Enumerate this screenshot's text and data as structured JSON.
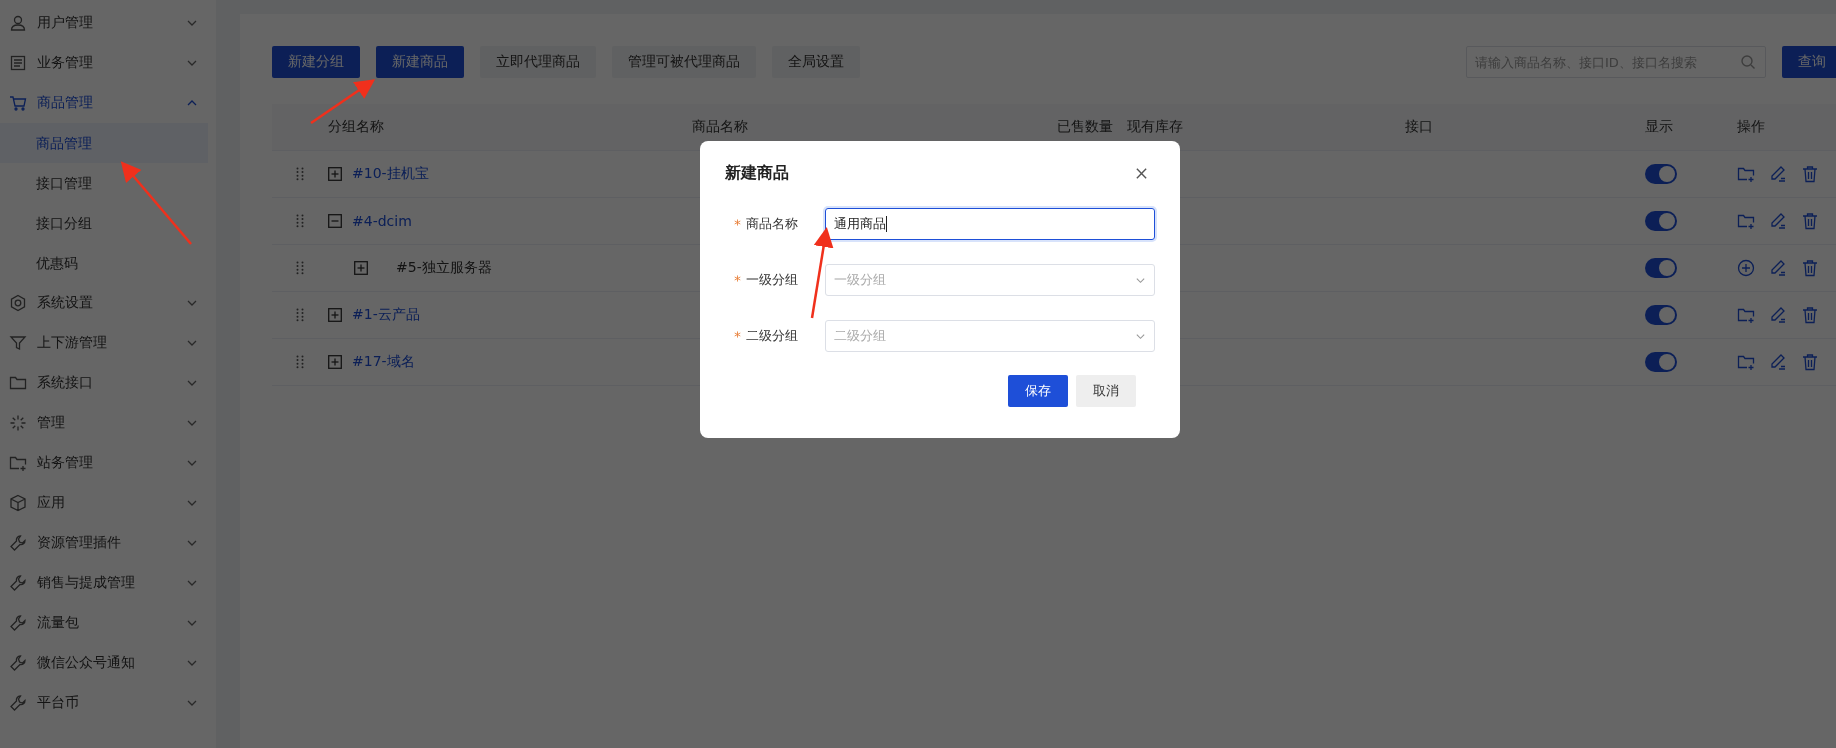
{
  "sidebar": {
    "items": [
      {
        "label": "用户管理",
        "expanded": false
      },
      {
        "label": "业务管理",
        "expanded": false
      },
      {
        "label": "商品管理",
        "expanded": true,
        "children": [
          {
            "label": "商品管理",
            "selected": true
          },
          {
            "label": "接口管理",
            "selected": false
          },
          {
            "label": "接口分组",
            "selected": false
          },
          {
            "label": "优惠码",
            "selected": false
          }
        ]
      },
      {
        "label": "系统设置",
        "expanded": false
      },
      {
        "label": "上下游管理",
        "expanded": false
      },
      {
        "label": "系统接口",
        "expanded": false
      },
      {
        "label": "管理",
        "expanded": false
      },
      {
        "label": "站务管理",
        "expanded": false
      },
      {
        "label": "应用",
        "expanded": false
      },
      {
        "label": "资源管理插件",
        "expanded": false
      },
      {
        "label": "销售与提成管理",
        "expanded": false
      },
      {
        "label": "流量包",
        "expanded": false
      },
      {
        "label": "微信公众号通知",
        "expanded": false
      },
      {
        "label": "平台币",
        "expanded": false
      }
    ]
  },
  "toolbar": {
    "buttons": [
      {
        "label": "新建分组",
        "kind": "primary"
      },
      {
        "label": "新建商品",
        "kind": "primary"
      },
      {
        "label": "立即代理商品",
        "kind": "plain"
      },
      {
        "label": "管理可被代理商品",
        "kind": "plain"
      },
      {
        "label": "全局设置",
        "kind": "plain"
      }
    ],
    "search": {
      "placeholder": "请输入商品名称、接口ID、接口名搜索"
    },
    "query_button": "查询"
  },
  "table": {
    "columns": [
      "分组名称",
      "商品名称",
      "已售数量",
      "现有库存",
      "接口",
      "显示",
      "操作"
    ],
    "rows": [
      {
        "name": "#10-挂机宝",
        "expanded": false,
        "on": true
      },
      {
        "name": "#4-dcim",
        "expanded": true,
        "on": true,
        "children": [
          {
            "name": "#5-独立服务器",
            "expanded": false,
            "on": true
          }
        ]
      },
      {
        "name": "#1-云产品",
        "expanded": false,
        "on": true
      },
      {
        "name": "#17-域名",
        "expanded": false,
        "on": true
      }
    ]
  },
  "dialog": {
    "title": "新建商品",
    "fields": [
      {
        "label": "商品名称",
        "kind": "input",
        "required": true,
        "value": "通用商品"
      },
      {
        "label": "一级分组",
        "kind": "select",
        "required": true,
        "placeholder": "一级分组"
      },
      {
        "label": "二级分组",
        "kind": "select",
        "required": true,
        "placeholder": "二级分组"
      }
    ],
    "buttons": [
      {
        "label": "保存",
        "kind": "primary"
      },
      {
        "label": "取消",
        "kind": "plain"
      }
    ]
  }
}
